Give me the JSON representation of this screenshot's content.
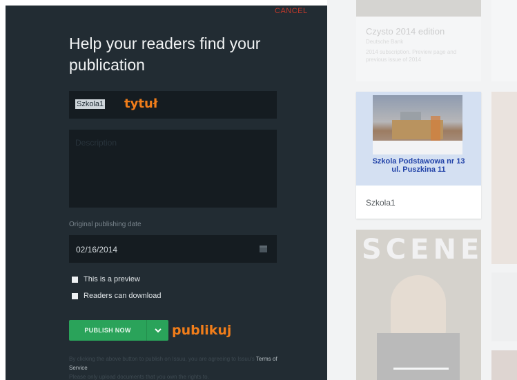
{
  "dialog": {
    "cancel_label": "CANCEL",
    "heading": "Help your readers find your publication",
    "title_value": "Szkola1",
    "title_annotation": "tytuł",
    "description_placeholder": "Description",
    "date_label": "Original publishing date",
    "date_value": "02/16/2014",
    "preview_label": "This is a preview",
    "download_label": "Readers can download",
    "publish_label": "PUBLISH NOW",
    "publish_annotation": "publikuj",
    "terms_prefix": "By clicking the above button to publish on Issuu, you are agreeing to Issuu's",
    "terms_link": "Terms of Service",
    "terms_suffix": "Please only upload documents that you own the rights to."
  },
  "library": {
    "top_card_title": "Czysto 2014 edition",
    "top_card_meta": "Deutsche Bank",
    "top_card_desc": "2014 subscription. Preview page and previous issue of 2014",
    "main_card_name": "Szkola1",
    "cover_text_line1": "Szkola Podstawowa nr 13",
    "cover_text_line2": "ul. Puszkina 11",
    "scene_title": "SCENE"
  }
}
